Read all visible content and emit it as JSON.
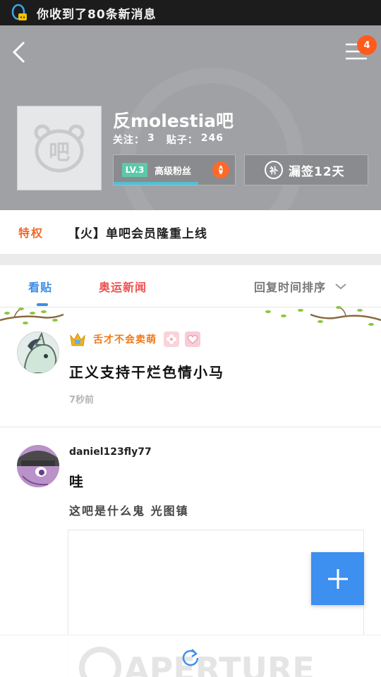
{
  "status_bar": {
    "notification": "你收到了80条新消息"
  },
  "header": {
    "menu_badge": "4",
    "forum_name": "反molestia吧",
    "follow_label": "关注：",
    "follow_count": "3",
    "posts_label": "贴子：",
    "posts_count": "246",
    "level_tag": "LV.3",
    "level_title": "高级粉丝",
    "level_progress": 0.7,
    "signin_icon_text": "补",
    "signin_label": "漏签12天"
  },
  "privilege": {
    "label": "特权",
    "text": "【火】单吧会员隆重上线"
  },
  "tabs": {
    "posts": "看贴",
    "news": "奥运新闻",
    "sort": "回复时间排序"
  },
  "posts": [
    {
      "username": "舌才不会卖萌",
      "title": "正义支持干烂色情小马",
      "time": "7秒前"
    },
    {
      "username": "daniel123fly77",
      "title": "哇",
      "body": "这吧是什么鬼 光图镇"
    }
  ],
  "watermark": "APERTURE",
  "colors": {
    "accent": "#3d8ff0",
    "privilege": "#f26a2a",
    "news_tab": "#ef5050",
    "badge": "#ff5b1d"
  }
}
